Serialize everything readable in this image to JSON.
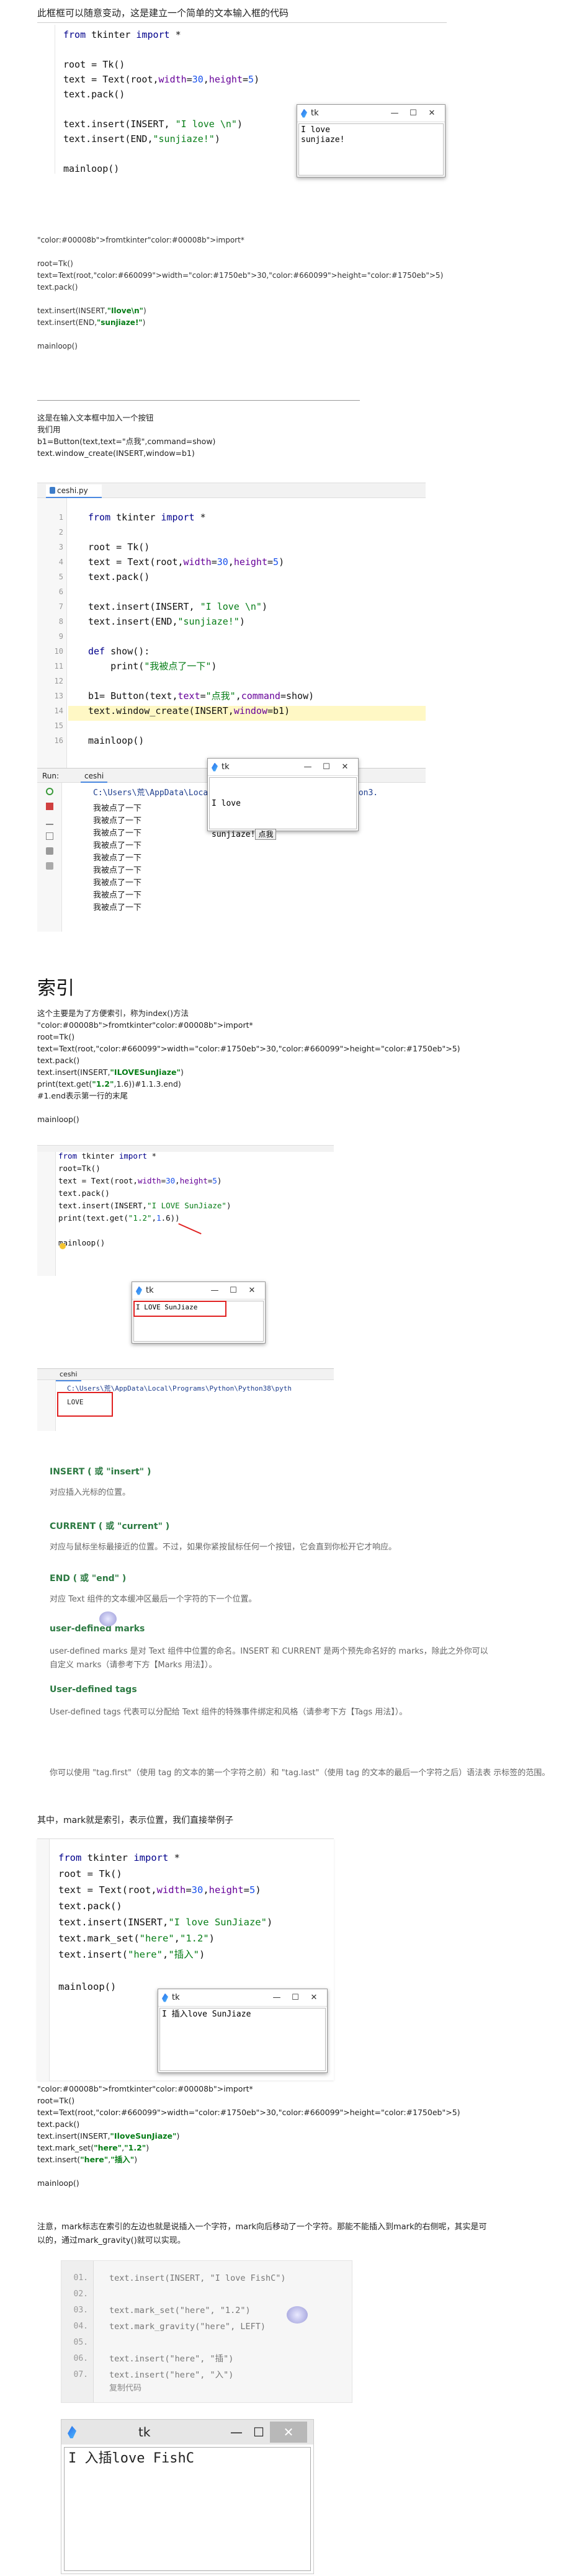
{
  "intro": "此框框可以随意变动，这是建立一个简单的文本输入框的代码",
  "code1": {
    "lines": [
      "from tkinter import *",
      "",
      "root = Tk()",
      "text = Text(root,width=30,height=5)",
      "text.pack()",
      "",
      "text.insert(INSERT, \"I love \\n\")",
      "text.insert(END,\"sunjiaze!\")",
      "",
      "mainloop()"
    ]
  },
  "tk_title": "tk",
  "tk_min": "—",
  "tk_max": "☐",
  "tk_close": "✕",
  "win1_body": "I love\nsunjiaze!",
  "plain1": {
    "lines": [
      "fromtkinterimport*",
      "",
      "root=Tk()",
      "text=Text(root,width=30,height=5)",
      "text.pack()",
      "",
      "text.insert(INSERT,\"Ilove\\n\")",
      "text.insert(END,\"sunjiaze!\")",
      "",
      "mainloop()"
    ]
  },
  "sec2": {
    "lines": [
      "这是在输入文本框中加入一个按钮",
      "我们用",
      "b1=Button(text,text=\"点我\",command=show)",
      "text.window_create(INSERT,window=b1)"
    ]
  },
  "ide": {
    "tab": "ceshi.py",
    "lines": [
      "from tkinter import *",
      "",
      "root = Tk()",
      "text = Text(root,width=30,height=5)",
      "text.pack()",
      "",
      "text.insert(INSERT, \"I love \\n\")",
      "text.insert(END,\"sunjiaze!\")",
      "",
      "def show():",
      "    print(\"我被点了一下\")",
      "",
      "b1= Button(text,text=\"点我\",command=show)",
      "text.window_create(INSERT,window=b1)",
      "",
      "mainloop()"
    ],
    "gutter": [
      "1",
      "2",
      "3",
      "4",
      "5",
      "6",
      "7",
      "8",
      "9",
      "10",
      "11",
      "12",
      "13",
      "14",
      "15",
      "16"
    ],
    "run_label": "Run:",
    "run_tab": "ceshi",
    "run_path": "C:\\Users\\荒\\AppData\\Local\\Programs\\Python\\Python38\\python3.",
    "outputs": [
      "我被点了一下",
      "我被点了一下",
      "我被点了一下",
      "我被点了一下",
      "我被点了一下",
      "我被点了一下",
      "我被点了一下",
      "我被点了一下",
      "我被点了一下"
    ],
    "win_body1": "I love",
    "win_body2": "sunjiaze!",
    "win_btn": "点我"
  },
  "index": {
    "heading": "索引",
    "lines": [
      "这个主要是为了方便索引，称为index()方法",
      "fromtkinterimport*",
      "root=Tk()",
      "text=Text(root,width=30,height=5)",
      "text.pack()",
      "text.insert(INSERT,\"ILOVESunJiaze\")",
      "print(text.get(\"1.2\",1.6))#1.1.3.end)",
      "#1.end表示第一行的末尾",
      "",
      "mainloop()"
    ]
  },
  "ide2": {
    "lines": [
      "from tkinter import *",
      "root=Tk()",
      "text = Text(root,width=30,height=5)",
      "text.pack()",
      "text.insert(INSERT,\"I LOVE SunJiaze\")",
      "print(text.get(\"1.2\",1.6))",
      "",
      "mainloop()"
    ],
    "win_body": "I LOVE SunJiaze",
    "tab": "ceshi",
    "path": "C:\\Users\\荒\\AppData\\Local\\Programs\\Python\\Python38\\pyth",
    "out": "LOVE"
  },
  "marks": [
    {
      "title": "INSERT ( 或 \"insert\" )",
      "desc": "对应插入光标的位置。"
    },
    {
      "title": "CURRENT ( 或 \"current\" )",
      "desc": "对应与鼠标坐标最接近的位置。不过，如果你紧按鼠标任何一个按钮，它会直到你松开它才响应。"
    },
    {
      "title": "END ( 或 \"end\" )",
      "desc": "对应 Text 组件的文本缓冲区最后一个字符的下一个位置。"
    },
    {
      "title": "user-defined marks",
      "desc": "user-defined marks 是对 Text 组件中位置的命名。INSERT 和 CURRENT 是两个预先命名好的 marks，除此之外你可以\n自定义 marks（请参考下方【Marks 用法】）。"
    },
    {
      "title": "User-defined tags",
      "desc": "User-defined tags 代表可以分配给 Text 组件的特殊事件绑定和风格（请参考下方【Tags 用法】）。"
    }
  ],
  "tags_note": "你可以使用 \"tag.first\"（使用 tag 的文本的第一个字符之前）和 \"tag.last\"（使用 tag 的文本的最后一个字符之后）语法表\n示标签的范围。",
  "mark_intro": "其中，mark就是索引，表示位置，我们直接举例子",
  "code3": {
    "lines": [
      "from tkinter import *",
      "root = Tk()",
      "text = Text(root,width=30,height=5)",
      "text.pack()",
      "text.insert(INSERT,\"I love SunJiaze\")",
      "text.mark_set(\"here\",\"1.2\")",
      "text.insert(\"here\",\"插入\")",
      "",
      "mainloop()"
    ]
  },
  "win3_body": "I 插入love SunJiaze",
  "plain3": {
    "lines": [
      "fromtkinterimport*",
      "root=Tk()",
      "text=Text(root,width=30,height=5)",
      "text.pack()",
      "text.insert(INSERT,\"IloveSunJiaze\")",
      "text.mark_set(\"here\",\"1.2\")",
      "text.insert(\"here\",\"插入\")",
      "",
      "mainloop()"
    ]
  },
  "note": "注意，mark标志在索引的左边也就是说插入一个字符，mark向后移动了一个字符。那能不能插入到mark的右侧呢，其实是可\n以的，通过mark_gravity()就可以实现。",
  "code4": {
    "nums": [
      "01.",
      "02.",
      "03.",
      "04.",
      "05.",
      "06.",
      "07."
    ],
    "lines": [
      "text.insert(INSERT, \"I love FishC\")",
      "",
      "text.mark_set(\"here\", \"1.2\")",
      "text.mark_gravity(\"here\", LEFT)",
      "",
      "text.insert(\"here\", \"插\")",
      "text.insert(\"here\", \"入\")"
    ],
    "copy": "复制代码"
  },
  "win4_body": "I 入插love FishC"
}
